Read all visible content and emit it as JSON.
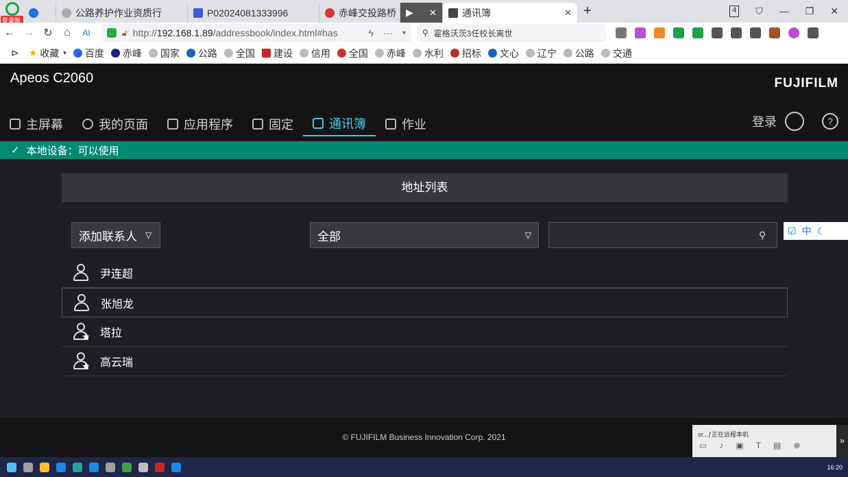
{
  "browser": {
    "badge": "登录账号",
    "tabs": [
      {
        "label": "公路养护作业资质行",
        "active": false
      },
      {
        "label": "P02024081333996",
        "active": false
      },
      {
        "label": "赤峰交投路桥",
        "active": false
      },
      {
        "label": "",
        "active": false
      },
      {
        "label": "通讯簿",
        "active": true
      }
    ],
    "tab_count": "4",
    "url_prefix": "http://",
    "url_host": "192.168.1.89",
    "url_path": "/addressbook/index.html#has",
    "search_text": "霍格沃茨3任校长离世",
    "bookmarks": [
      "收藏",
      "百度",
      "赤峰",
      "国家",
      "公路",
      "全国",
      "建设",
      "信用",
      "全国",
      "赤峰",
      "水利",
      "招标",
      "文心",
      "辽宁",
      "公路",
      "交通"
    ]
  },
  "app": {
    "model": "Apeos C2060",
    "brand": "FUJIFILM",
    "nav": [
      {
        "label": "主屏幕",
        "active": false
      },
      {
        "label": "我的页面",
        "active": false
      },
      {
        "label": "应用程序",
        "active": false
      },
      {
        "label": "固定",
        "active": false
      },
      {
        "label": "通讯簿",
        "active": true
      },
      {
        "label": "作业",
        "active": false
      }
    ],
    "login_label": "登录",
    "help": "?",
    "status_text": "本地设备：可以使用",
    "section_title": "地址列表",
    "add_contact_label": "添加联系人",
    "filter_value": "全部",
    "search_value": "",
    "contacts": [
      {
        "name": "尹连超",
        "favorite": false
      },
      {
        "name": "张旭龙",
        "favorite": false
      },
      {
        "name": "塔拉",
        "favorite": true
      },
      {
        "name": "高云瑞",
        "favorite": true
      }
    ],
    "footer": "© FUJIFILM Business Innovation Corp. 2021"
  },
  "ime": {
    "mode": "中"
  },
  "remote": {
    "text": "or...ƒ正在远程本机"
  },
  "taskbar": {
    "time": "16:20"
  }
}
